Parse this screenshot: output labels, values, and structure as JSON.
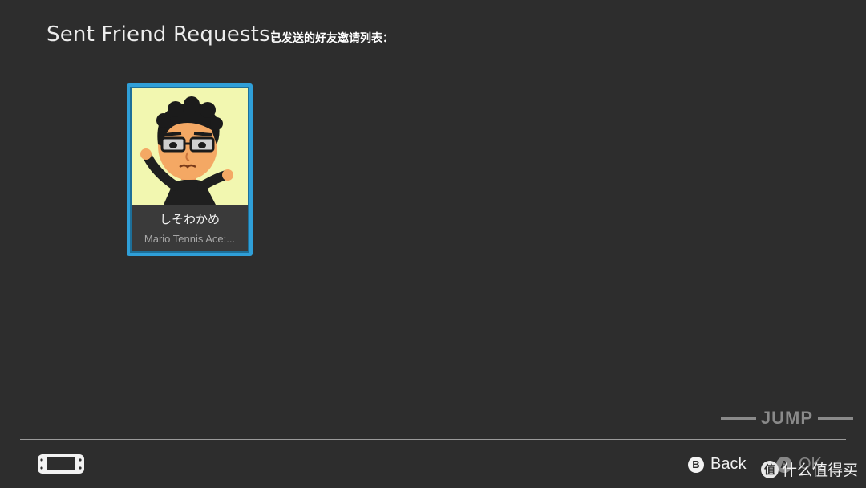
{
  "header": {
    "title": "Sent Friend Requests:",
    "note": "已发送的好友邀请列表："
  },
  "friend_requests": [
    {
      "name": "しそわかめ",
      "subtitle": "Mario Tennis Ace:...",
      "avatar_icon": "mii-avatar-glasses-icon",
      "avatar_background": "#f2f7b0"
    }
  ],
  "selection_color": "#2f9fd8",
  "watermark": {
    "text": "JUMP"
  },
  "footer": {
    "console_icon": "switch-console-icon",
    "buttons": [
      {
        "key": "B",
        "label": "Back"
      },
      {
        "key": "A",
        "label": "OK"
      }
    ]
  },
  "corner_watermark": {
    "logo": "值",
    "text": "什么值得买"
  }
}
